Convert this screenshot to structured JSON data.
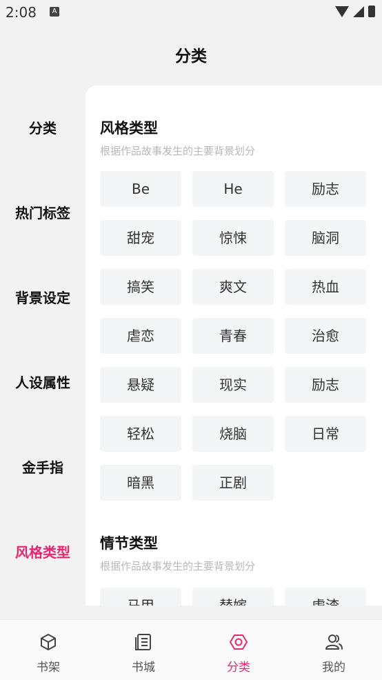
{
  "status_bar": {
    "time": "2:08",
    "notification_badge": "A"
  },
  "header": {
    "title": "分类"
  },
  "sidebar": {
    "items": [
      {
        "label": "分类",
        "active": false
      },
      {
        "label": "热门标签",
        "active": false
      },
      {
        "label": "背景设定",
        "active": false
      },
      {
        "label": "人设属性",
        "active": false
      },
      {
        "label": "金手指",
        "active": false
      },
      {
        "label": "风格类型",
        "active": true
      }
    ]
  },
  "sections": [
    {
      "title": "风格类型",
      "description": "根据作品故事发生的主要背景划分",
      "tags": [
        "Be",
        "He",
        "励志",
        "甜宠",
        "惊悚",
        "脑洞",
        "搞笑",
        "爽文",
        "热血",
        "虐恋",
        "青春",
        "治愈",
        "悬疑",
        "现实",
        "励志",
        "轻松",
        "烧脑",
        "日常",
        "暗黑",
        "正剧"
      ]
    },
    {
      "title": "情节类型",
      "description": "根据作品故事发生的主要背景划分",
      "tags": [
        "马甲",
        "替嫁",
        "虐渣"
      ]
    }
  ],
  "bottom_nav": {
    "items": [
      {
        "label": "书架",
        "icon": "cube-icon",
        "active": false
      },
      {
        "label": "书城",
        "icon": "book-icon",
        "active": false
      },
      {
        "label": "分类",
        "icon": "hexagon-icon",
        "active": true
      },
      {
        "label": "我的",
        "icon": "user-icon",
        "active": false
      }
    ]
  },
  "colors": {
    "accent": "#e8266f",
    "tag_bg": "#f4f5f7",
    "muted_text": "#b8b8b8"
  }
}
